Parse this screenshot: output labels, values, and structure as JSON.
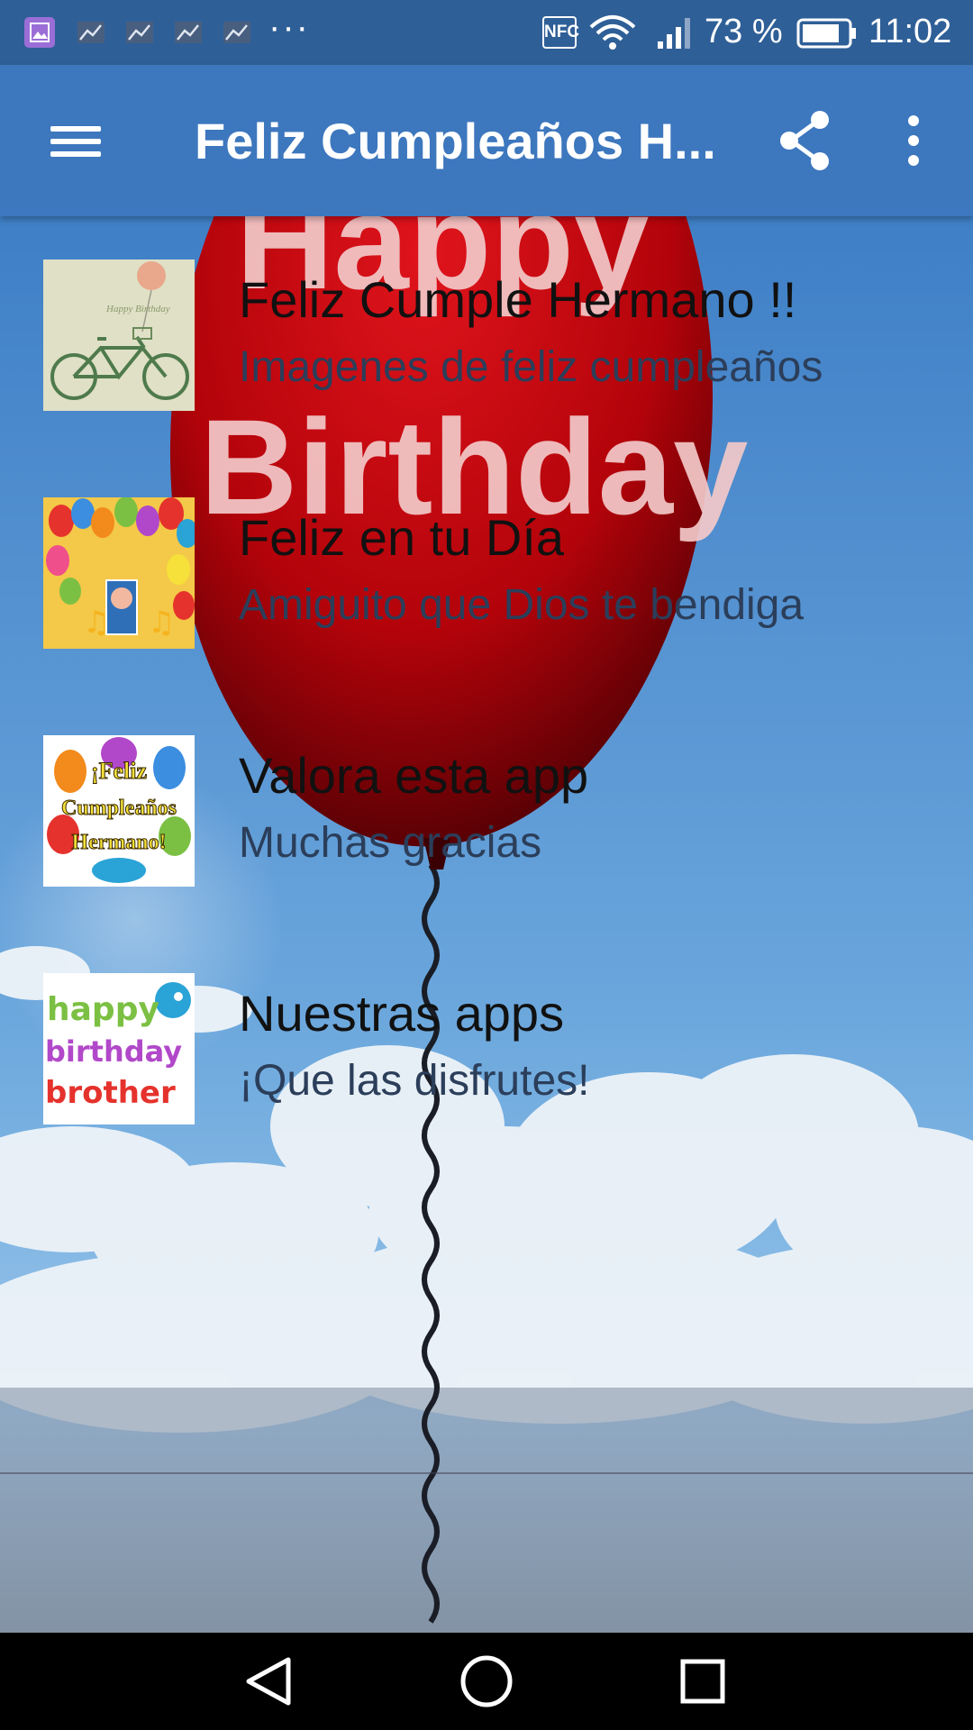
{
  "status_bar": {
    "battery": "73 %",
    "time": "11:02",
    "nfc": "NFC",
    "more_notifications": "···"
  },
  "app_bar": {
    "title": "Feliz Cumpleaños H..."
  },
  "background": {
    "balloon_text_line1": "Happy",
    "balloon_text_line2": "Birthday"
  },
  "list": [
    {
      "title": "Feliz Cumple Hermano !!",
      "subtitle": "Imagenes de feliz cumpleaños",
      "thumb_text": "Happy Birthday"
    },
    {
      "title": "Feliz en tu Día",
      "subtitle": "Amiguito que Dios te bendiga"
    },
    {
      "title": "Valora esta app",
      "subtitle": "Muchas gracias",
      "thumb_text_1": "¡Feliz",
      "thumb_text_2": "Cumpleaños",
      "thumb_text_3": "Hermano!"
    },
    {
      "title": "Nuestras apps",
      "subtitle": "¡Que las disfrutes!",
      "thumb_text_1": "happy",
      "thumb_text_2": "birthday",
      "thumb_text_3": "brother"
    }
  ],
  "colors": {
    "status_bar": "#2f5f97",
    "app_bar": "#3d77be",
    "balloon": "#c4040a"
  }
}
